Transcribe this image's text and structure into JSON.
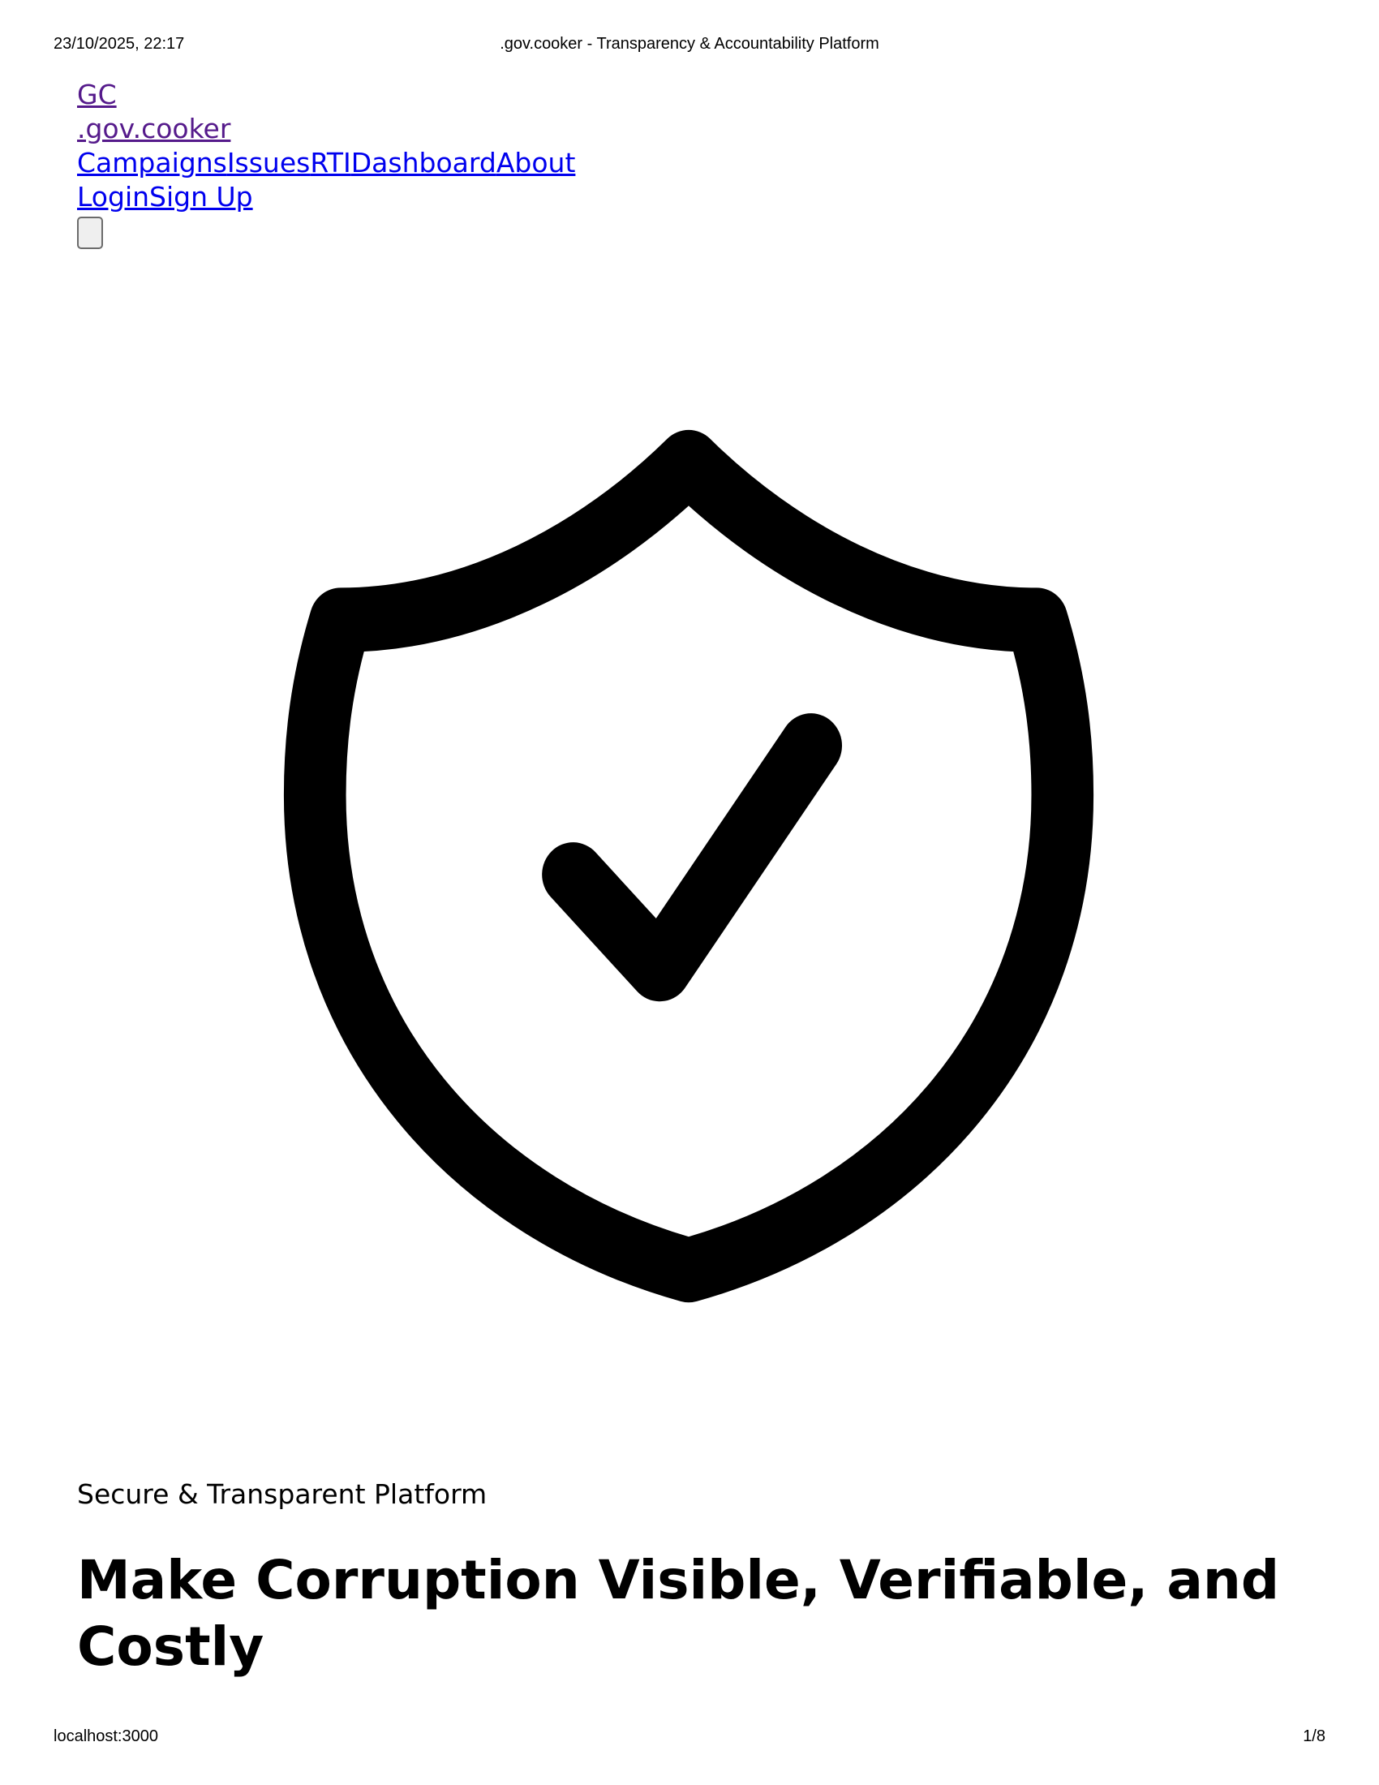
{
  "print_header": {
    "datetime": "23/10/2025, 22:17",
    "title": ".gov.cooker - Transparency & Accountability Platform"
  },
  "print_footer": {
    "url": "localhost:3000",
    "page": "1/8"
  },
  "nav": {
    "logo_mark": "GC",
    "logo_text": ".gov.cooker",
    "links": [
      "Campaigns",
      "Issues",
      "RTI",
      "Dashboard",
      "About"
    ],
    "auth": {
      "login": "Login",
      "signup": "Sign Up"
    },
    "menu_icon": "menu-toggle"
  },
  "hero": {
    "icon": "shield-check-icon",
    "tagline": "Secure & Transparent Platform",
    "headline": "Make Corruption Visible, Verifiable, and Costly"
  },
  "colors": {
    "link": "#0000ee",
    "visited_link": "#551a8b",
    "text": "#000000",
    "background": "#ffffff"
  }
}
